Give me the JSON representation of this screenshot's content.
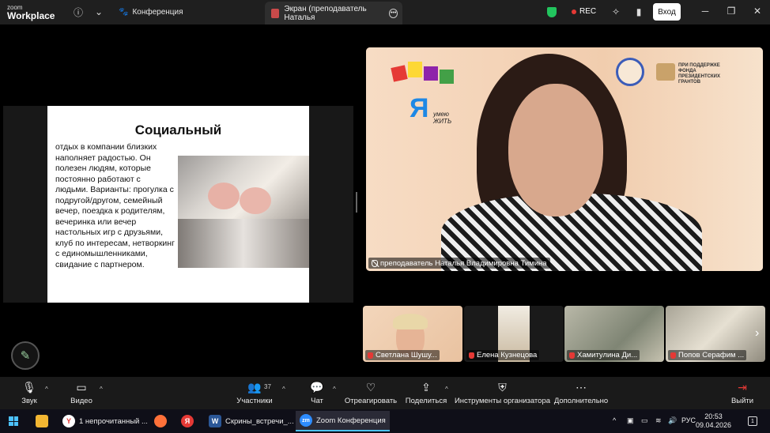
{
  "app": {
    "logo_line1": "zoom",
    "logo_line2": "Workplace"
  },
  "titlebar": {
    "meeting_tab": "Конференция",
    "share_tab": "Экран (преподаватель Наталья",
    "rec_label": "REC",
    "login_label": "Вход",
    "colors": {
      "bg": "#1f1f1f",
      "shield": "#22c55e",
      "rec_dot": "#e53935"
    }
  },
  "slide": {
    "title": "Социальный",
    "body": "отдых в компании близких наполняет радостью. Он полезен людям, которые постоянно работают с людьми. Варианты: прогулка с подругой/другом, семейный вечер, поездка к родителям, вечеринка или вечер настольных игр с друзьями, клуб по интересам, нетворкинг с единомышленниками, свидание с партнером."
  },
  "speaker": {
    "name": "преподаватель Наталья Владимировна Тимина",
    "logo_left_text": "умею ЖИТЬ",
    "logo_right_text": "ПРИ ПОДДЕРЖКЕ ФОНДА ПРЕЗИДЕНТСКИХ ГРАНТОВ"
  },
  "thumbnails": [
    {
      "name": "Светлана Шушу..."
    },
    {
      "name": "Елена Кузнецова"
    },
    {
      "name": "Хамитулина Ди..."
    },
    {
      "name": "Попов Серафим ..."
    }
  ],
  "toolbar": {
    "audio": "Звук",
    "video": "Видео",
    "participants": "Участники",
    "participants_count": "37",
    "chat": "Чат",
    "react": "Отреагировать",
    "share": "Поделиться",
    "host_tools": "Инструменты организатора",
    "more": "Дополнительно",
    "leave": "Выйти"
  },
  "taskbar": {
    "items": [
      {
        "label": "1 непрочитанный ...",
        "icon": "yandex-mail-icon"
      },
      {
        "label": "",
        "icon": "firefox-icon"
      },
      {
        "label": "",
        "icon": "yandex-browser-icon"
      },
      {
        "label": "Скрины_встречи_...",
        "icon": "word-icon"
      },
      {
        "label": "Zoom Конференция",
        "icon": "zoom-icon"
      }
    ],
    "language": "РУС",
    "time": "20:53",
    "date": "09.04.2026",
    "notif_count": "1"
  }
}
